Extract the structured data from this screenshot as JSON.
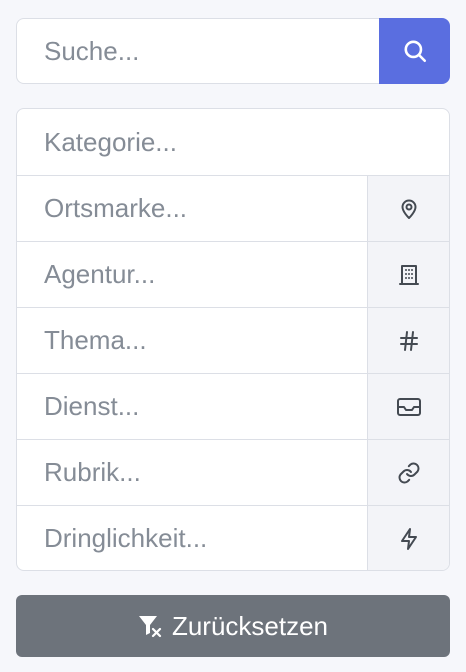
{
  "search": {
    "placeholder": "Suche...",
    "button_icon": "search-icon",
    "button_color": "#5a6ee0"
  },
  "filters": {
    "category": {
      "placeholder": "Kategorie..."
    },
    "fields": [
      {
        "placeholder": "Ortsmarke...",
        "icon": "map-pin-icon"
      },
      {
        "placeholder": "Agentur...",
        "icon": "building-icon"
      },
      {
        "placeholder": "Thema...",
        "icon": "hashtag-icon"
      },
      {
        "placeholder": "Dienst...",
        "icon": "inbox-icon"
      },
      {
        "placeholder": "Rubrik...",
        "icon": "link-icon"
      },
      {
        "placeholder": "Dringlichkeit...",
        "icon": "bolt-icon"
      }
    ]
  },
  "reset": {
    "label": "Zurücksetzen",
    "icon": "filter-clear-icon",
    "color": "#6d737b"
  }
}
